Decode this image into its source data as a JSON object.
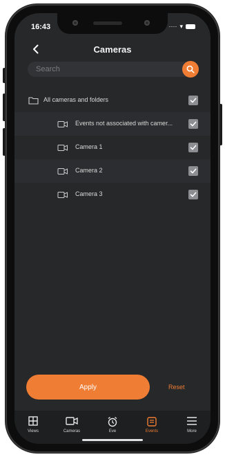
{
  "status": {
    "time": "16:43"
  },
  "header": {
    "title": "Cameras"
  },
  "search": {
    "placeholder": "Search"
  },
  "list": {
    "root": {
      "label": "All cameras and folders",
      "checked": true
    },
    "items": [
      {
        "label": "Events not associated with camer...",
        "checked": true
      },
      {
        "label": "Camera 1",
        "checked": true
      },
      {
        "label": "Camera 2",
        "checked": true
      },
      {
        "label": "Camera 3",
        "checked": true
      }
    ]
  },
  "actions": {
    "apply": "Apply",
    "reset": "Reset"
  },
  "tabs": [
    {
      "label": "Views",
      "icon": "grid-icon"
    },
    {
      "label": "Cameras",
      "icon": "camera-icon"
    },
    {
      "label": "Eve",
      "icon": "alarm-clock-icon"
    },
    {
      "label": "Events",
      "icon": "events-icon",
      "active": true
    },
    {
      "label": "More",
      "icon": "menu-icon"
    }
  ],
  "colors": {
    "accent": "#f07d34",
    "background": "#27282a",
    "checkbox": "#8d8e92"
  }
}
